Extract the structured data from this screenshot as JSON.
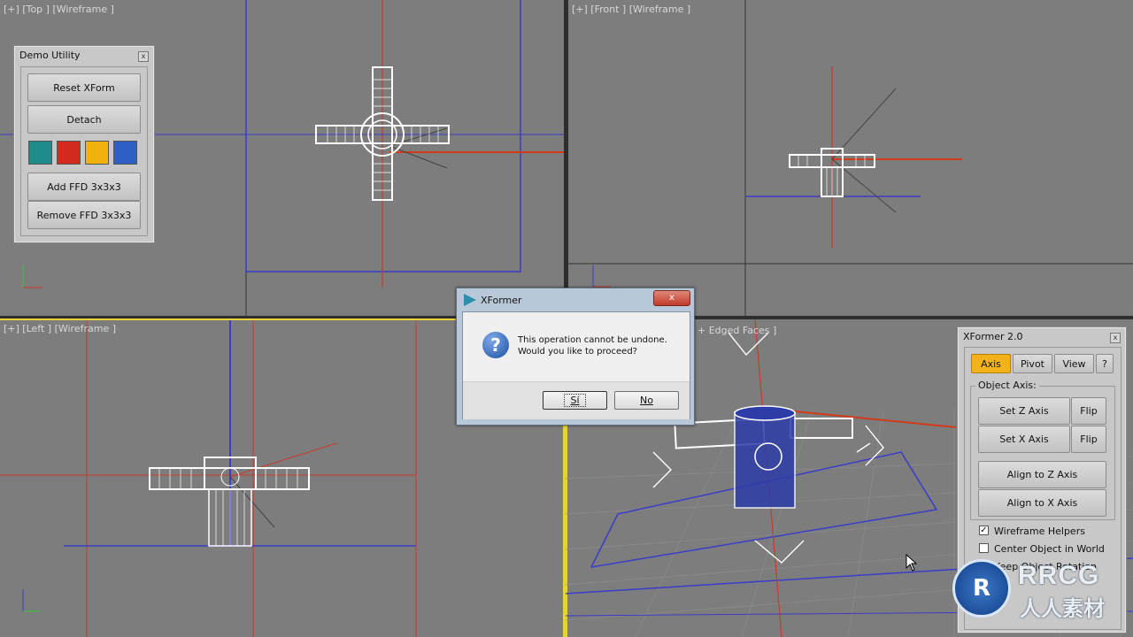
{
  "viewports": {
    "top_label": "[+] [Top ] [Wireframe ]",
    "front_label": "[+] [Front ] [Wireframe ]",
    "left_label": "[+] [Left ] [Wireframe ]",
    "persp_label": "+ Edged Faces ]"
  },
  "demo_utility": {
    "title": "Demo Utility",
    "close": "x",
    "reset_xform": "Reset XForm",
    "detach": "Detach",
    "colors": [
      "#1f8c8c",
      "#d42a1e",
      "#f2b10f",
      "#2f5fc4"
    ],
    "add_ffd": "Add FFD 3x3x3",
    "remove_ffd": "Remove FFD 3x3x3"
  },
  "dialog": {
    "title": "XFormer",
    "close": "x",
    "message_line1": "This operation cannot be undone.",
    "message_line2": "Would you like to proceed?",
    "yes_label": "Sí",
    "no_label": "No",
    "icon": "question-icon"
  },
  "xformer": {
    "title": "XFormer 2.0",
    "close": "x",
    "tabs": [
      "Axis",
      "Pivot",
      "View",
      "?"
    ],
    "group_label": "Object Axis:",
    "set_z": "Set Z Axis",
    "set_x": "Set X Axis",
    "flip": "Flip",
    "align_z": "Align to Z Axis",
    "align_x": "Align to X Axis",
    "wireframe_helpers": "Wireframe Helpers",
    "center_object": "Center Object in World",
    "keep_rotation": "Keep Object Rotation",
    "wireframe_checked": true
  },
  "watermark": {
    "brand": "RRCG",
    "sub": "人人素材"
  },
  "colors": {
    "viewport_bg": "#7d7d7d",
    "active_border": "#e8d23a",
    "grid_red": "#c83a2a",
    "grid_blue": "#3a3ad0"
  }
}
